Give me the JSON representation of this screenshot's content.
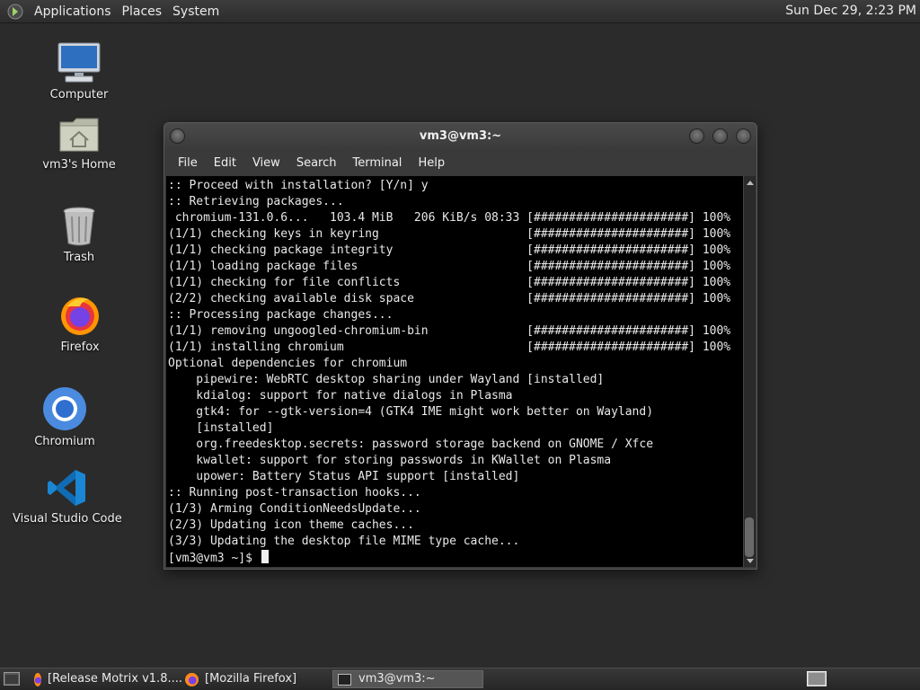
{
  "top_panel": {
    "menus": [
      "Applications",
      "Places",
      "System"
    ],
    "clock": "Sun Dec 29,  2:23 PM"
  },
  "desktop_icons": [
    {
      "label": "Computer",
      "icon": "computer-icon"
    },
    {
      "label": "vm3's Home",
      "icon": "home-folder-icon"
    },
    {
      "label": "Trash",
      "icon": "trash-icon"
    },
    {
      "label": "Firefox",
      "icon": "firefox-icon"
    },
    {
      "label": "Chromium",
      "icon": "chromium-icon"
    },
    {
      "label": "Visual Studio Code",
      "icon": "vscode-icon"
    }
  ],
  "window": {
    "title": "vm3@vm3:~",
    "menus": [
      "File",
      "Edit",
      "View",
      "Search",
      "Terminal",
      "Help"
    ]
  },
  "terminal": {
    "lines": [
      ":: Proceed with installation? [Y/n] y",
      ":: Retrieving packages...",
      " chromium-131.0.6...   103.4 MiB   206 KiB/s 08:33 [######################] 100%",
      "(1/1) checking keys in keyring                     [######################] 100%",
      "(1/1) checking package integrity                   [######################] 100%",
      "(1/1) loading package files                        [######################] 100%",
      "(1/1) checking for file conflicts                  [######################] 100%",
      "(2/2) checking available disk space                [######################] 100%",
      ":: Processing package changes...",
      "(1/1) removing ungoogled-chromium-bin              [######################] 100%",
      "(1/1) installing chromium                          [######################] 100%",
      "Optional dependencies for chromium",
      "    pipewire: WebRTC desktop sharing under Wayland [installed]",
      "    kdialog: support for native dialogs in Plasma",
      "    gtk4: for --gtk-version=4 (GTK4 IME might work better on Wayland)",
      "    [installed]",
      "    org.freedesktop.secrets: password storage backend on GNOME / Xfce",
      "    kwallet: support for storing passwords in KWallet on Plasma",
      "    upower: Battery Status API support [installed]",
      ":: Running post-transaction hooks...",
      "(1/3) Arming ConditionNeedsUpdate...",
      "(2/3) Updating icon theme caches...",
      "(3/3) Updating the desktop file MIME type cache..."
    ],
    "prompt": "[vm3@vm3 ~]$ "
  },
  "taskbar": {
    "tasks": [
      {
        "label": "[Release Motrix v1.8....",
        "icon": "firefox-icon"
      },
      {
        "label": "[Mozilla Firefox]",
        "icon": "firefox-icon"
      },
      {
        "label": "vm3@vm3:~",
        "icon": "terminal-icon",
        "active": true
      }
    ]
  }
}
